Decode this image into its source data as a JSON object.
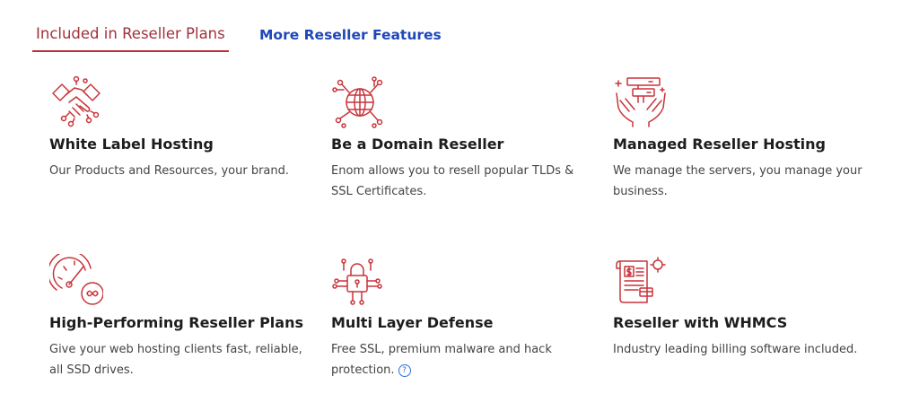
{
  "tabs": [
    {
      "label": "Included in Reseller Plans",
      "active": true
    },
    {
      "label": "More Reseller Features",
      "active": false
    }
  ],
  "features": [
    {
      "icon": "handshake-icon",
      "title": "White Label Hosting",
      "desc": "Our Products and Resources, your brand."
    },
    {
      "icon": "globe-network-icon",
      "title": "Be a Domain Reseller",
      "desc": "Enom allows you to resell popular TLDs & SSL Certificates."
    },
    {
      "icon": "hands-server-icon",
      "title": "Managed Reseller Hosting",
      "desc": "We manage the servers, you manage your business."
    },
    {
      "icon": "speedometer-infinity-icon",
      "title": "High-Performing Reseller Plans",
      "desc": "Give your web hosting clients fast, reliable, all SSD drives."
    },
    {
      "icon": "lock-circuit-icon",
      "title": "Multi Layer Defense",
      "desc": "Free SSL, premium malware and hack protection."
    },
    {
      "icon": "invoice-gear-icon",
      "title": "Reseller with WHMCS",
      "desc": "Industry leading billing software included."
    }
  ],
  "help_icon": "question-circle-icon",
  "colors": {
    "accent": "#c8343a",
    "link": "#1f47b8"
  }
}
